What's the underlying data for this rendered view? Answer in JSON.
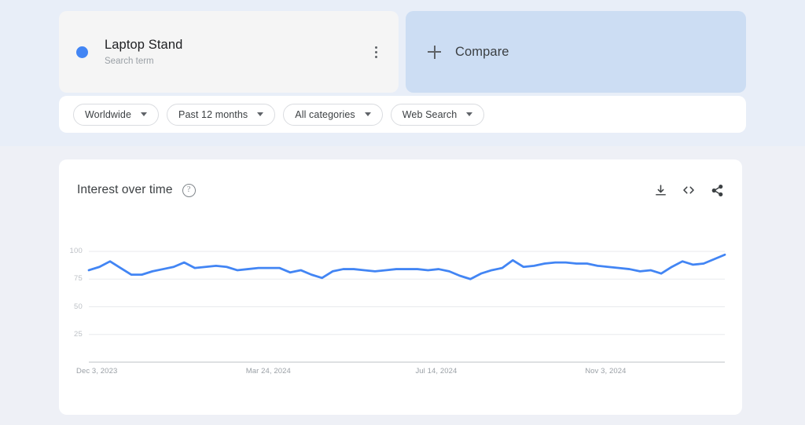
{
  "colors": {
    "series_blue": "#4285f4",
    "compare_bg": "#ccddf3",
    "term_bg": "#f5f5f5",
    "page_bg_top": "#e8eef8",
    "page_bg_bottom": "#eef0f6"
  },
  "term_card": {
    "title": "Laptop Stand",
    "subtitle": "Search term",
    "menu_icon": "kebab-menu-icon"
  },
  "compare_card": {
    "label": "Compare",
    "icon": "plus-icon"
  },
  "filters": [
    {
      "label": "Worldwide",
      "name": "location-filter"
    },
    {
      "label": "Past 12 months",
      "name": "time-range-filter"
    },
    {
      "label": "All categories",
      "name": "category-filter"
    },
    {
      "label": "Web Search",
      "name": "search-type-filter"
    }
  ],
  "chart_panel": {
    "title": "Interest over time",
    "help_glyph": "?",
    "actions": [
      {
        "name": "download-csv-button",
        "icon": "download-icon"
      },
      {
        "name": "embed-code-button",
        "icon": "embed-code-icon"
      },
      {
        "name": "share-button",
        "icon": "share-icon"
      }
    ]
  },
  "chart_data": {
    "type": "line",
    "title": "Interest over time",
    "xlabel": "",
    "ylabel": "",
    "ylim": [
      0,
      100
    ],
    "yticks": [
      100,
      75,
      50,
      25
    ],
    "grid": true,
    "legend_position": "none",
    "xtick_labels": [
      "Dec 3, 2023",
      "Mar 24, 2024",
      "Jul 14, 2024",
      "Nov 3, 2024"
    ],
    "xtick_indices": [
      0,
      16,
      32,
      48
    ],
    "series": [
      {
        "name": "Laptop Stand",
        "color": "#4285f4",
        "values": [
          83,
          86,
          91,
          85,
          79,
          79,
          82,
          84,
          86,
          90,
          85,
          86,
          87,
          86,
          83,
          84,
          85,
          85,
          85,
          81,
          83,
          79,
          76,
          82,
          84,
          84,
          83,
          82,
          83,
          84,
          84,
          84,
          83,
          84,
          82,
          78,
          75,
          80,
          83,
          85,
          92,
          86,
          87,
          89,
          90,
          90,
          89,
          89,
          87,
          86,
          85,
          84,
          82,
          83,
          80,
          86,
          91,
          88,
          89,
          93,
          97
        ]
      }
    ]
  }
}
